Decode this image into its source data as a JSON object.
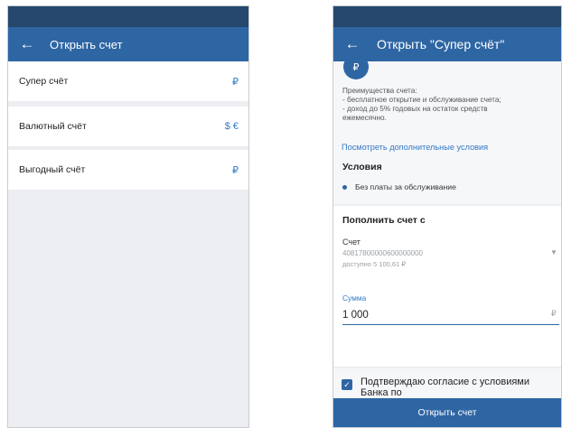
{
  "left": {
    "title": "Открыть счет",
    "accounts": [
      {
        "name": "Супер счёт",
        "currency": "₽"
      },
      {
        "name": "Валютный счёт",
        "currency": "$ €"
      },
      {
        "name": "Выгодный счёт",
        "currency": "₽"
      }
    ]
  },
  "right": {
    "title": "Открыть \"Супер счёт\"",
    "rub_symbol": "₽",
    "benefits": "Преимущества счета:\n- бесплатное открытие и обслуживание счета;\n- доход до 5% годовых на остаток средств\nежемесячно.",
    "conditions_link": "Посмотреть дополнительные условия",
    "conditions_title": "Условия",
    "conditions": [
      "Без платы за обслуживание"
    ],
    "fund_title": "Пополнить счет с",
    "account_label": "Счет",
    "account_number": "40817800000600000000",
    "account_available": "доступно 5 100,61 ₽",
    "amount_label": "Сумма",
    "amount_value": "1 000",
    "amount_currency": "₽",
    "agree_text": "Подтверждаю согласие с условиями Банка по",
    "agree_checked": true,
    "open_button": "Открыть счет"
  },
  "colors": {
    "statusbar": "#26486e",
    "appbar": "#2e66a4",
    "accent": "#3279c6"
  }
}
